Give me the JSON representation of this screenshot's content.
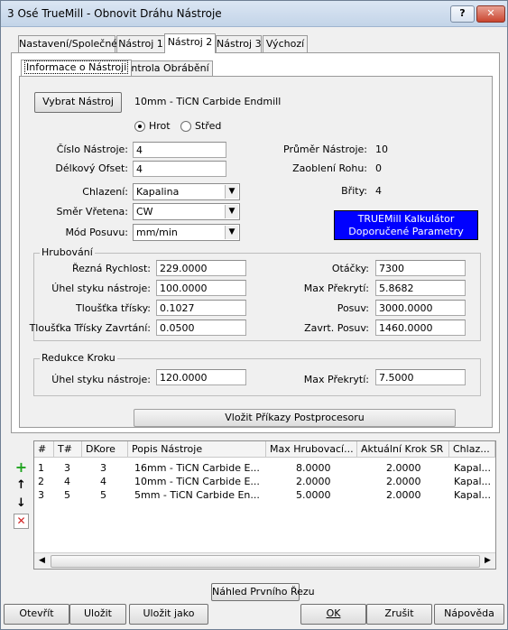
{
  "window": {
    "title": "3 Osé TrueMill - Obnovit Dráhu Nástroje",
    "help_label": "?",
    "close_label": "✕"
  },
  "tabs": [
    "Nastavení/Společné",
    "Nástroj 1",
    "Nástroj 2",
    "Nástroj 3",
    "Výchozí"
  ],
  "subtabs": [
    "Informace o Nástroji",
    "Kontrola Obrábění"
  ],
  "tool": {
    "select_label": "Vybrat Nástroj",
    "name": "10mm - TiCN Carbide Endmill",
    "radio_tip": "Hrot",
    "radio_center": "Střed",
    "number_label": "Číslo Nástroje:",
    "number_value": "4",
    "length_offset_label": "Délkový Ofset:",
    "length_offset_value": "4",
    "coolant_label": "Chlazení:",
    "coolant_value": "Kapalina",
    "spindle_label": "Směr Vřetena:",
    "spindle_value": "CW",
    "feed_mode_label": "Mód Posuvu:",
    "feed_mode_value": "mm/min",
    "diameter_label": "Průměr Nástroje:",
    "diameter_value": "10",
    "corner_label": "Zaoblení Rohu:",
    "corner_value": "0",
    "flutes_label": "Břity:",
    "flutes_value": "4",
    "calc_line1": "TRUEMill Kalkulátor",
    "calc_line2": "Doporučené Parametry"
  },
  "roughing": {
    "title": "Hrubování",
    "cut_speed_label": "Řezná Rychlost:",
    "cut_speed_value": "229.0000",
    "engage_label": "Úhel styku nástroje:",
    "engage_value": "100.0000",
    "chip_label": "Tloušťka třísky:",
    "chip_value": "0.1027",
    "plunge_chip_label": "Tloušťka Třísky Zavrtání:",
    "plunge_chip_value": "0.0500",
    "rpm_label": "Otáčky:",
    "rpm_value": "7300",
    "max_overlap_label": "Max Překrytí:",
    "max_overlap_value": "5.8682",
    "feed_label": "Posuv:",
    "feed_value": "3000.0000",
    "plunge_feed_label": "Zavrt. Posuv:",
    "plunge_feed_value": "1460.0000"
  },
  "stepdown": {
    "title": "Redukce Kroku",
    "engage_label": "Úhel styku nástroje:",
    "engage_value": "120.0000",
    "max_overlap_label": "Max Překrytí:",
    "max_overlap_value": "7.5000"
  },
  "post_button": "Vložit Příkazy Postprocesoru",
  "table": {
    "headers": [
      "#",
      "T#",
      "DKore",
      "Popis Nástroje",
      "Max Hrubovací...",
      "Aktuální Krok SR",
      "Chlaz..."
    ],
    "rows": [
      [
        "1",
        "3",
        "3",
        "16mm - TiCN Carbide E...",
        "8.0000",
        "2.0000",
        "Kapal..."
      ],
      [
        "2",
        "4",
        "4",
        "10mm - TiCN Carbide E...",
        "2.0000",
        "2.0000",
        "Kapal..."
      ],
      [
        "3",
        "5",
        "5",
        "5mm - TiCN Carbide En...",
        "5.0000",
        "2.0000",
        "Kapal..."
      ]
    ]
  },
  "preview_button": "Náhled Prvního Řezu",
  "footer": {
    "open": "Otevřít",
    "save": "Uložit",
    "save_as": "Uložit jako",
    "ok": "OK",
    "cancel": "Zrušit",
    "help": "Nápověda"
  },
  "colors": {
    "accent_blue": "#0000ff",
    "add_green": "#1fa31f",
    "delete_red": "#d02020"
  }
}
